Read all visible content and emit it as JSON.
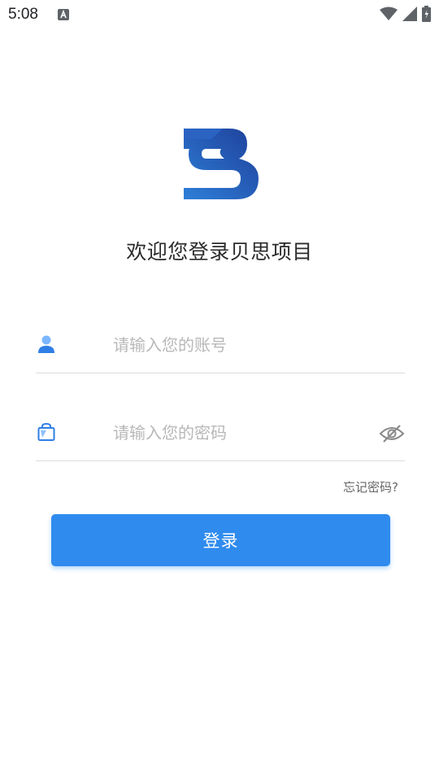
{
  "status_bar": {
    "time": "5:08",
    "icons": [
      "keyboard-a-icon",
      "wifi-icon",
      "cell-signal-icon",
      "battery-icon"
    ]
  },
  "logo": {
    "icon": "app-logo-icon",
    "colors": [
      "#1e4fa8",
      "#2e7fd8"
    ]
  },
  "welcome_title": "欢迎您登录贝思项目",
  "username": {
    "icon": "user-icon",
    "placeholder": "请输入您的账号",
    "value": ""
  },
  "password": {
    "icon": "lock-icon",
    "placeholder": "请输入您的密码",
    "value": "",
    "toggle_icon": "eye-off-icon"
  },
  "forgot_password": "忘记密码?",
  "login_button": "登录",
  "colors": {
    "primary": "#2f8bee",
    "divider": "#dcdcdc",
    "placeholder": "#b8b8b8"
  }
}
